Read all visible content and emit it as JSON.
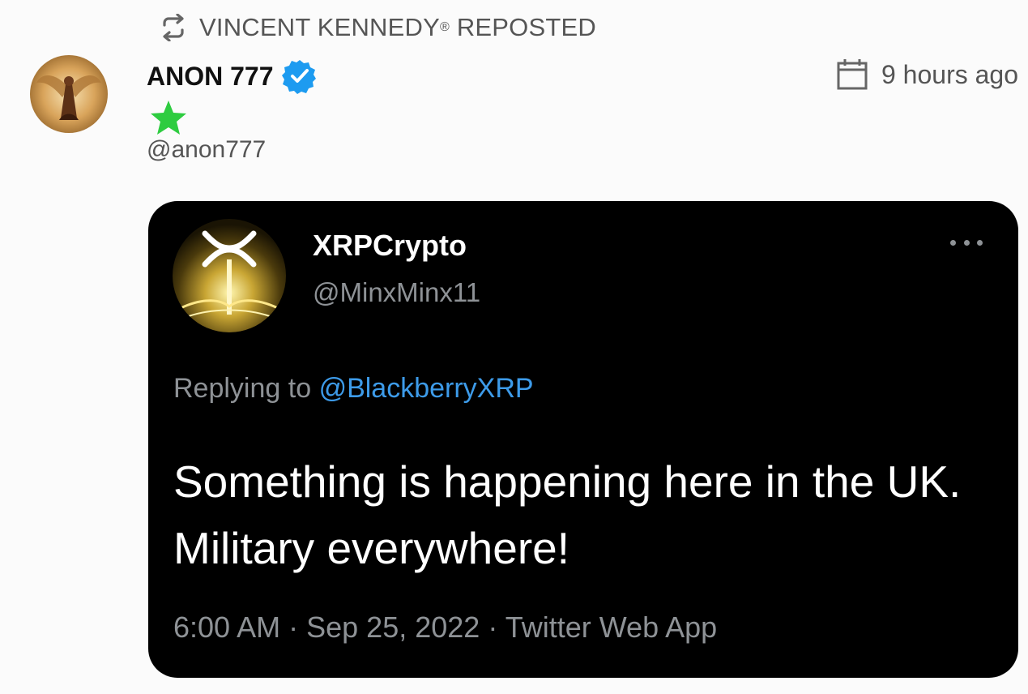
{
  "repost": {
    "icon": "repost-icon",
    "user_name": "VINCENT KENNEDY",
    "mark": "®",
    "label": "REPOSTED"
  },
  "author": {
    "name": "ANON 777",
    "verified_icon": "verified-badge-icon",
    "star_icon": "green-star-icon",
    "handle": "@anon777",
    "avatar": "angel-avatar"
  },
  "timestamp": {
    "icon": "calendar-icon",
    "text": "9 hours ago"
  },
  "embedded_tweet": {
    "avatar": "xrp-logo-avatar",
    "display_name": "XRPCrypto",
    "handle": "@MinxMinx11",
    "more_icon": "more-options-icon",
    "replying_prefix": "Replying to",
    "replying_to": "@BlackberryXRP",
    "text": "Something is happening here in the UK. Military everywhere!",
    "time": "6:00 AM",
    "date": "Sep 25, 2022",
    "source": "Twitter Web App",
    "separator": "·"
  },
  "colors": {
    "page_background": "#fbfbfb",
    "card_background": "#000000",
    "link_blue": "#3d9be9",
    "verified_blue": "#1d9bf0",
    "star_green": "#2ecc40",
    "muted_text": "#8e9296"
  }
}
